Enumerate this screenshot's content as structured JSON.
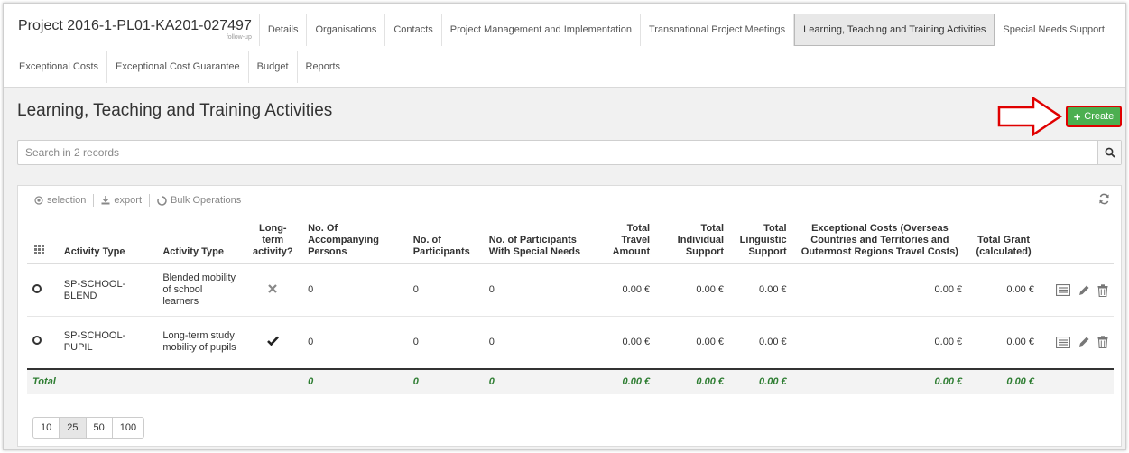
{
  "header": {
    "project_title": "Project 2016-1-PL01-KA201-027497",
    "project_subtitle": "follow-up",
    "tabs_row1": [
      "Details",
      "Organisations",
      "Contacts",
      "Project Management and Implementation",
      "Transnational Project Meetings",
      "Learning, Teaching and Training Activities",
      "Special Needs Support"
    ],
    "tabs_row2": [
      "Exceptional Costs",
      "Exceptional Cost Guarantee",
      "Budget",
      "Reports"
    ],
    "active_tab": "Learning, Teaching and Training Activities"
  },
  "page": {
    "title": "Learning, Teaching and Training Activities",
    "create_label": "Create",
    "accent_color": "#4caf50",
    "highlight_color": "#e00000"
  },
  "search": {
    "placeholder": "Search in 2 records",
    "icon": "search-icon"
  },
  "toolbar": {
    "selection_label": "selection",
    "export_label": "export",
    "bulk_label": "Bulk Operations"
  },
  "table": {
    "columns": [
      "Activity Type",
      "Activity Type",
      "Long-term activity?",
      "No. Of Accompanying Persons",
      "No. of Participants",
      "No. of Participants With Special Needs",
      "Total Travel Amount",
      "Total Individual Support",
      "Total Linguistic Support",
      "Exceptional Costs (Overseas Countries and Territories and Outermost Regions Travel Costs)",
      "Total Grant (calculated)"
    ],
    "rows": [
      {
        "code": "SP-SCHOOL-BLEND",
        "type": "Blended mobility of school learners",
        "long_term": false,
        "accompanying": "0",
        "participants": "0",
        "special_needs": "0",
        "travel": "0.00 €",
        "individual": "0.00 €",
        "linguistic": "0.00 €",
        "exceptional": "0.00 €",
        "grant": "0.00 €"
      },
      {
        "code": "SP-SCHOOL-PUPIL",
        "type": "Long-term study mobility of pupils",
        "long_term": true,
        "accompanying": "0",
        "participants": "0",
        "special_needs": "0",
        "travel": "0.00 €",
        "individual": "0.00 €",
        "linguistic": "0.00 €",
        "exceptional": "0.00 €",
        "grant": "0.00 €"
      }
    ],
    "total": {
      "label": "Total",
      "accompanying": "0",
      "participants": "0",
      "special_needs": "0",
      "travel": "0.00 €",
      "individual": "0.00 €",
      "linguistic": "0.00 €",
      "exceptional": "0.00 €",
      "grant": "0.00 €"
    }
  },
  "pager": {
    "sizes": [
      "10",
      "25",
      "50",
      "100"
    ],
    "selected": "25"
  }
}
